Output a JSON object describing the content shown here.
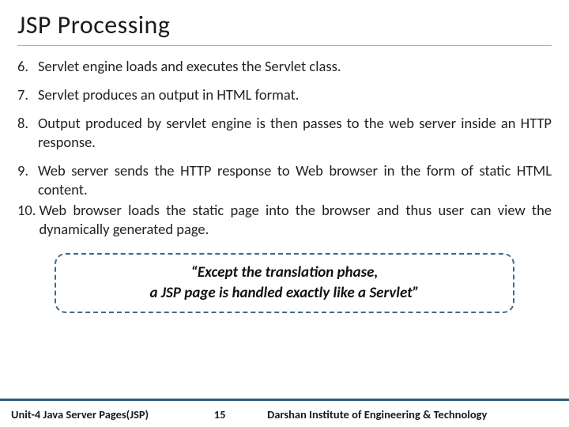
{
  "title": "JSP Processing",
  "items": [
    {
      "n": "6.",
      "text": "Servlet engine loads and executes the Servlet class."
    },
    {
      "n": "7.",
      "text": "Servlet produces an output in HTML format."
    },
    {
      "n": "8.",
      "text": "Output produced by servlet engine is then passes to the web server inside an HTTP response."
    },
    {
      "n": "9.",
      "text": "Web server sends the HTTP response to Web browser in the form of static HTML content."
    },
    {
      "n": "10.",
      "text": "Web browser loads the static page into the browser and thus user can view the dynamically generated page."
    }
  ],
  "quote_line1": "“Except the translation phase,",
  "quote_line2": "a JSP page is handled exactly like a Servlet”",
  "footer": {
    "left": "Unit-4 Java Server Pages(JSP)",
    "page": "15",
    "right": "Darshan Institute of Engineering & Technology"
  }
}
